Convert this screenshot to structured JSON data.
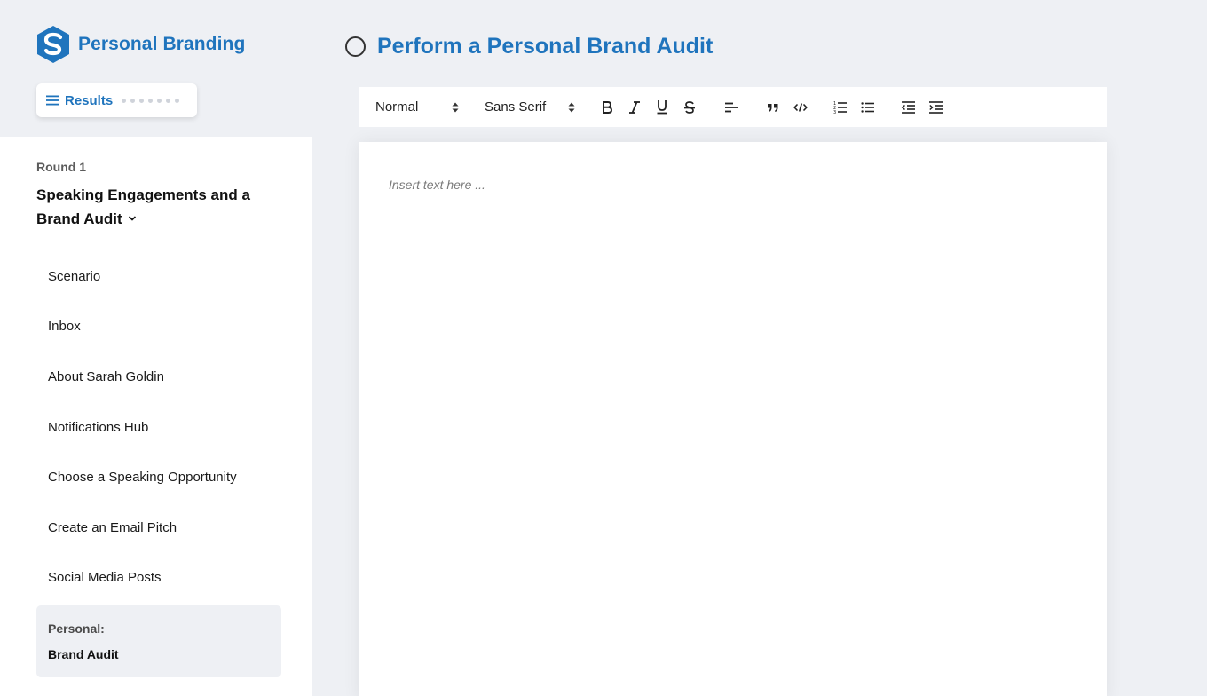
{
  "app": {
    "title": "Personal Branding",
    "brand_color": "#1f74bd"
  },
  "sidebar": {
    "results_label": "Results",
    "round_label": "Round 1",
    "module_title": "Speaking Engagements and a Brand Audit",
    "items": [
      {
        "label": "Scenario"
      },
      {
        "label": "Inbox"
      },
      {
        "label": "About Sarah Goldin"
      },
      {
        "label": "Notifications Hub"
      },
      {
        "label": "Choose a Speaking Opportunity"
      },
      {
        "label": "Create an Email Pitch"
      },
      {
        "label": "Social Media Posts"
      }
    ],
    "active_item": {
      "category": "Personal:",
      "label": "Brand Audit"
    }
  },
  "main": {
    "title": "Perform a Personal Brand Audit",
    "toolbar": {
      "text_style": "Normal",
      "font": "Sans Serif",
      "buttons": [
        "bold-icon",
        "italic-icon",
        "underline-icon",
        "strikethrough-icon",
        "align-left-icon",
        "blockquote-icon",
        "code-icon",
        "ordered-list-icon",
        "bullet-list-icon",
        "outdent-icon",
        "indent-icon"
      ]
    },
    "editor": {
      "placeholder": "Insert text here ..."
    }
  }
}
